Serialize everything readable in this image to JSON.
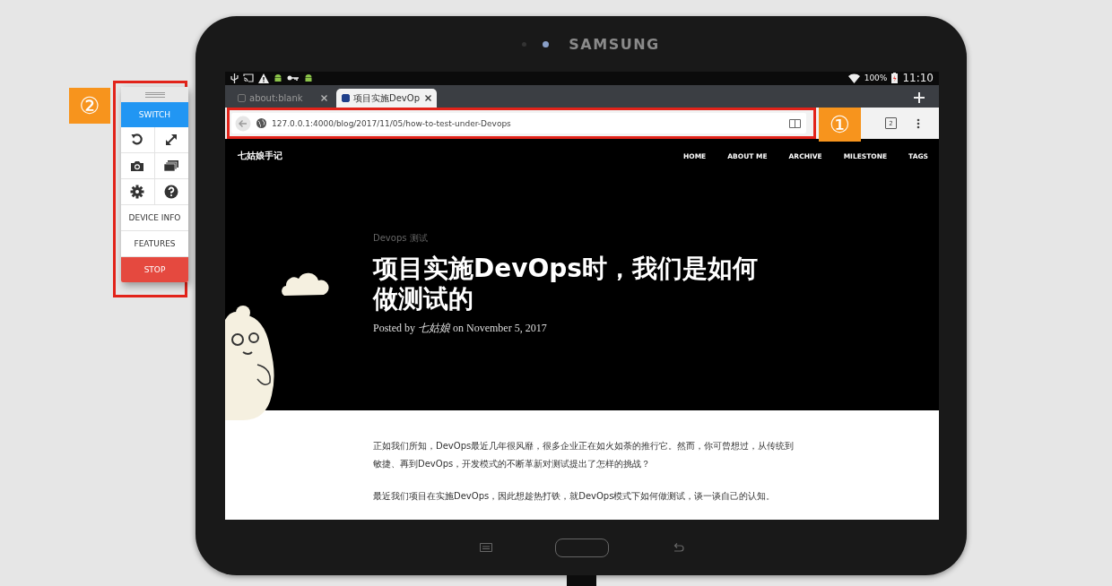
{
  "annotations": [
    {
      "label": "②"
    },
    {
      "label": "①"
    }
  ],
  "side_panel": {
    "switch_button": "SWITCH",
    "items": [
      "DEVICE INFO",
      "FEATURES"
    ],
    "stop_button": "STOP"
  },
  "device": {
    "brand": "SAMSUNG",
    "status_bar": {
      "battery": "100%",
      "time": "11:10"
    },
    "tabs": [
      {
        "title": "about:blank",
        "selected": false
      },
      {
        "title": "项目实施DevOp",
        "selected": true
      }
    ],
    "address_bar": {
      "url": "127.0.0.1:4000/blog/2017/11/05/how-to-test-under-Devops"
    },
    "tab_count": "2",
    "page": {
      "site_title": "七姑娘手记",
      "nav": [
        "HOME",
        "ABOUT ME",
        "ARCHIVE",
        "MILESTONE",
        "TAGS"
      ],
      "tag": "Devops 测试",
      "title": "项目实施DevOps时，我们是如何做测试的",
      "byline": "Posted by *七姑娘* on November 5, 2017",
      "paragraphs": [
        "正如我们所知，DevOps最近几年很风靡，很多企业正在如火如荼的推行它。然而，你可曾想过，从传统到敏捷、再到DevOps，开发模式的不断革新对测试提出了怎样的挑战？",
        "最近我们项目在实施DevOps，因此想趁热打铁，就DevOps模式下如何做测试，谈一谈自己的认知。"
      ]
    }
  }
}
